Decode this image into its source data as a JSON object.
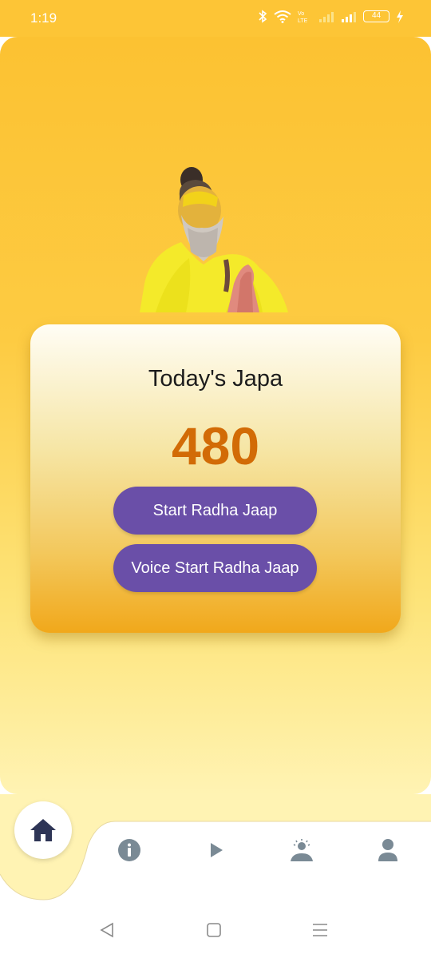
{
  "status_bar": {
    "time": "1:19",
    "battery": "44"
  },
  "card": {
    "title": "Today's Japa",
    "count": "480"
  },
  "buttons": {
    "start": "Start Radha Jaap",
    "voice_start": "Voice Start Radha Jaap"
  },
  "bottom_nav": {
    "items": [
      {
        "icon": "home-icon",
        "active": true
      },
      {
        "icon": "info-icon"
      },
      {
        "icon": "play-icon"
      },
      {
        "icon": "meditation-icon"
      },
      {
        "icon": "person-icon"
      }
    ],
    "active_color": "#2e3556",
    "inactive_color": "#7a8a95"
  },
  "colors": {
    "accent": "#6a4fa8",
    "count": "#d26b06",
    "header": "#fdc536"
  }
}
